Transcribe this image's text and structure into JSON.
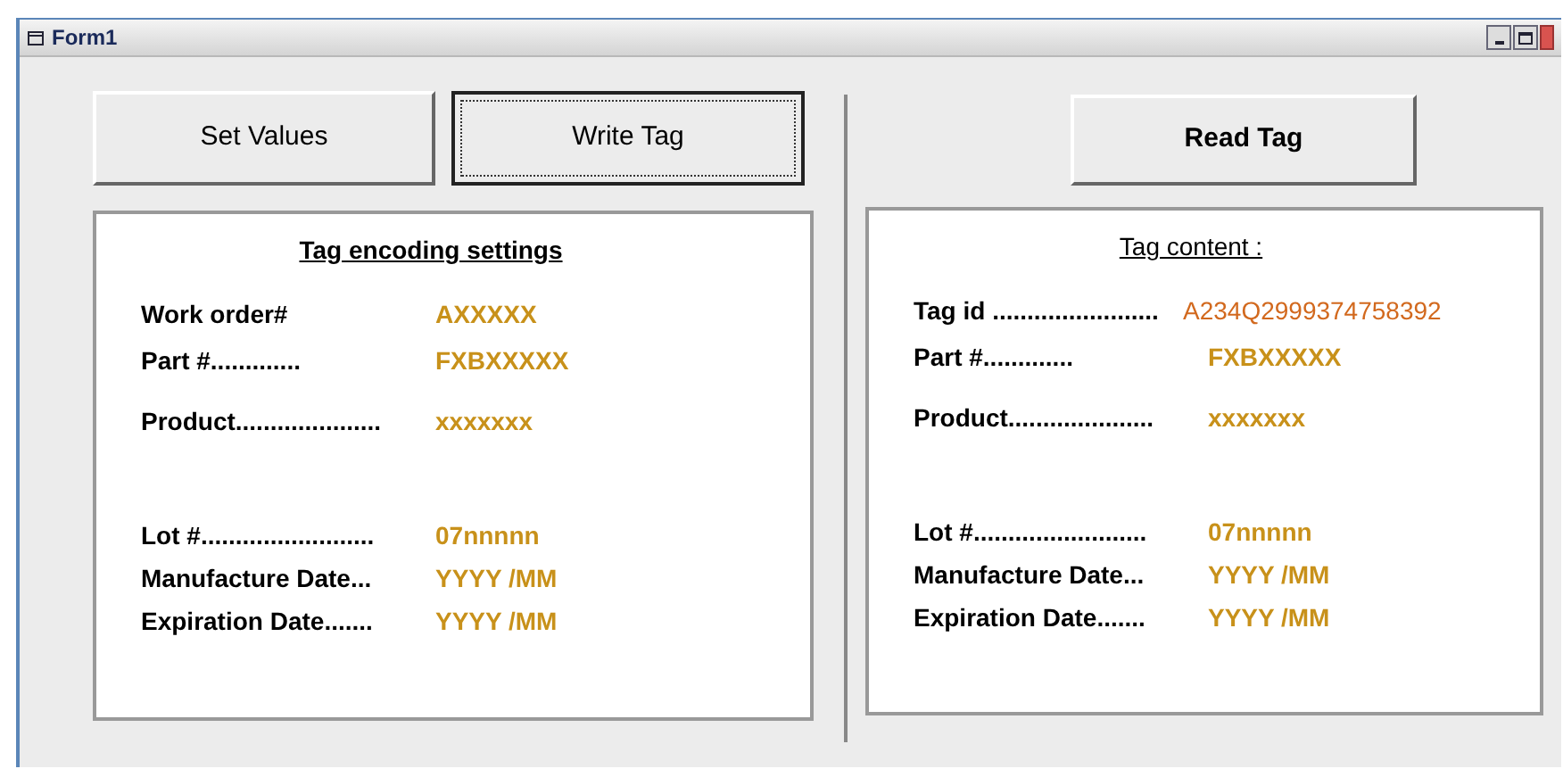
{
  "window": {
    "title": "Form1"
  },
  "left_buttons": [
    {
      "label": "Set Values",
      "focused": false
    },
    {
      "label": "Write Tag",
      "focused": true
    }
  ],
  "right_buttons": [
    {
      "label": "Read Tag",
      "focused": false
    }
  ],
  "panels": [
    {
      "title": "Tag encoding settings",
      "groups": [
        [
          {
            "kind": "field",
            "label": "Work order#",
            "value": "AXXXXX"
          },
          {
            "kind": "field",
            "label": "Part #.............",
            "value": "FXBXXXXX"
          },
          {
            "kind": "field",
            "label": "Product.....................",
            "value": "xxxxxxx"
          }
        ],
        [
          {
            "kind": "field",
            "label": "Lot #.........................",
            "value": "07nnnnn"
          },
          {
            "kind": "field",
            "label": "Manufacture Date...",
            "value": "YYYY /MM"
          },
          {
            "kind": "field",
            "label": "Expiration Date.......",
            "value": "YYYY /MM"
          }
        ]
      ]
    },
    {
      "title": "Tag content :",
      "groups": [
        [
          {
            "kind": "id",
            "label": "Tag id ........................",
            "value": "A234Q2999374758392"
          },
          {
            "kind": "field",
            "label": "Part #.............",
            "value": "FXBXXXXX"
          },
          {
            "kind": "field",
            "label": "Product.....................",
            "value": "xxxxxxx"
          }
        ],
        [
          {
            "kind": "field",
            "label": "Lot #.........................",
            "value": "07nnnnn"
          },
          {
            "kind": "field",
            "label": "Manufacture Date...",
            "value": "YYYY /MM"
          },
          {
            "kind": "field",
            "label": "Expiration Date.......",
            "value": "YYYY /MM"
          }
        ]
      ]
    }
  ]
}
